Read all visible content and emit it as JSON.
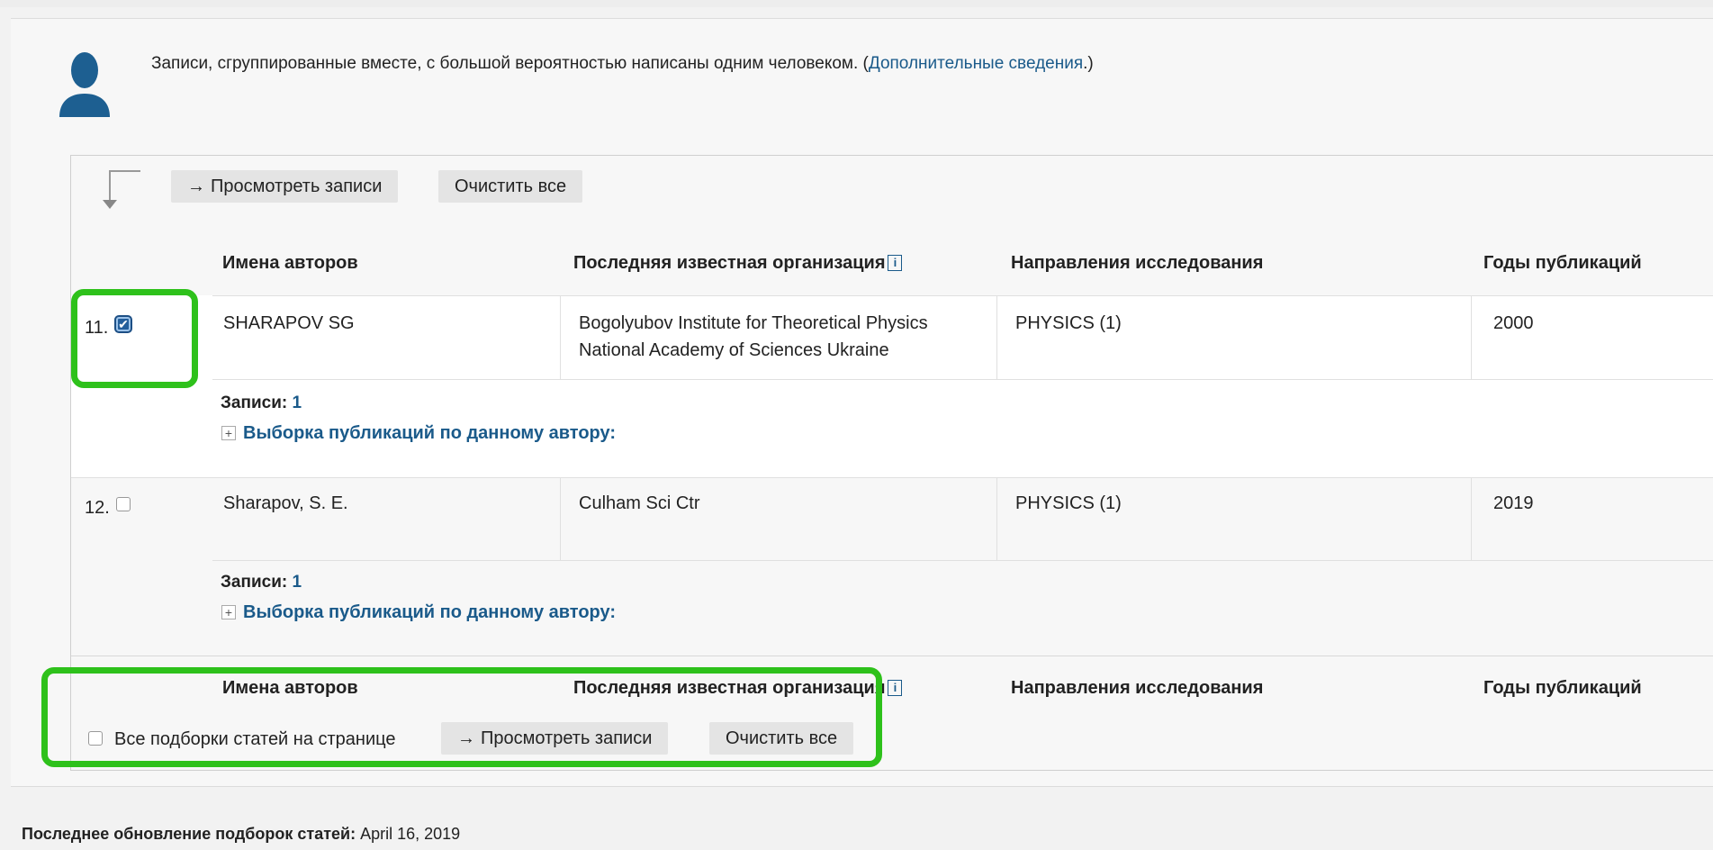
{
  "intro": {
    "text": "Записи, сгруппированные вместе, с большой вероятностью написаны одним человеком. (",
    "link": "Дополнительные сведения",
    "suffix": ".)"
  },
  "toolbar": {
    "view_records": "Просмотреть записи",
    "clear_all": "Очистить все"
  },
  "columns": {
    "authors": "Имена авторов",
    "organization": "Последняя известная организация",
    "research": "Направления исследования",
    "years": "Годы публикаций"
  },
  "info_glyph": "i",
  "rows": [
    {
      "index": "11.",
      "checked": true,
      "author": "SHARAPOV SG",
      "org_line1": "Bogolyubov Institute for Theoretical Physics",
      "org_line2": "National Academy of Sciences Ukraine",
      "research": "PHYSICS (1)",
      "years": "2000",
      "records_label": "Записи:",
      "records_value": "1",
      "expand_label": "Выборка публикаций по данному автору:"
    },
    {
      "index": "12.",
      "checked": false,
      "author": "Sharapov, S. E.",
      "org_line1": "Culham Sci Ctr",
      "org_line2": "",
      "research": "PHYSICS (1)",
      "years": "2019",
      "records_label": "Записи:",
      "records_value": "1",
      "expand_label": "Выборка публикаций по данному автору:"
    }
  ],
  "bottom": {
    "select_all": "Все подборки статей на странице",
    "view_records": "Просмотреть записи",
    "clear_all": "Очистить все"
  },
  "footer": {
    "label": "Последнее обновление подборок статей:",
    "date": "April 16, 2019"
  },
  "icons": {
    "arrow_right": "→",
    "checkmark": "✔",
    "plus": "+"
  },
  "colors": {
    "link": "#1a5a8a",
    "highlight": "#2ec11b",
    "checkbox_checked": "#245f9c"
  }
}
